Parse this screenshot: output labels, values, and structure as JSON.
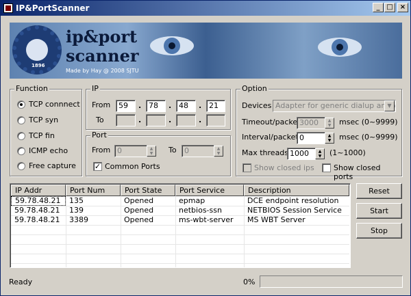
{
  "window": {
    "title": "IP&PortScanner"
  },
  "banner": {
    "line1": "ip&port",
    "line2": "scanner",
    "credit": "Made by Hay @ 2008 SJTU",
    "emblem_year": "1896"
  },
  "function": {
    "legend": "Function",
    "options": [
      {
        "label": "TCP connnect",
        "selected": true
      },
      {
        "label": "TCP syn",
        "selected": false
      },
      {
        "label": "TCP fin",
        "selected": false
      },
      {
        "label": "ICMP echo",
        "selected": false
      },
      {
        "label": "Free capture",
        "selected": false
      }
    ]
  },
  "ip": {
    "legend": "IP",
    "from_label": "From",
    "to_label": "To",
    "from": [
      "59",
      "78",
      "48",
      "21"
    ],
    "to": [
      "",
      "",
      "",
      ""
    ]
  },
  "port": {
    "legend": "Port",
    "from_label": "From",
    "to_label": "To",
    "from_value": "0",
    "to_value": "0",
    "common_ports_label": "Common Ports",
    "common_ports_checked": true
  },
  "option": {
    "legend": "Option",
    "devices_label": "Devices",
    "devices_value": "Adapter for generic dialup and VPN",
    "timeout_label": "Timeout/packet",
    "timeout_value": "3000",
    "timeout_hint": "msec (0~9999)",
    "interval_label": "Interval/packet",
    "interval_value": "0",
    "interval_hint": "msec (0~9999)",
    "threads_label": "Max threads",
    "threads_value": "1000",
    "threads_hint": "(1~1000)",
    "show_closed_ips_label": "Show closed ips",
    "show_closed_ports_label": "Show closed ports"
  },
  "results": {
    "columns": [
      "IP Addr",
      "Port Num",
      "Port State",
      "Port Service",
      "Description"
    ],
    "rows": [
      [
        "59.78.48.21",
        "135",
        "Opened",
        "epmap",
        "DCE endpoint resolution"
      ],
      [
        "59.78.48.21",
        "139",
        "Opened",
        "netbios-ssn",
        "NETBIOS Session Service"
      ],
      [
        "59.78.48.21",
        "3389",
        "Opened",
        "ms-wbt-server",
        "MS WBT Server"
      ]
    ]
  },
  "buttons": {
    "reset": "Reset",
    "start": "Start",
    "stop": "Stop"
  },
  "status": {
    "text": "Ready",
    "progress_label": "0%",
    "progress": 0
  },
  "colors": {
    "titlebar": "#0a246a",
    "face": "#d4d0c8"
  }
}
